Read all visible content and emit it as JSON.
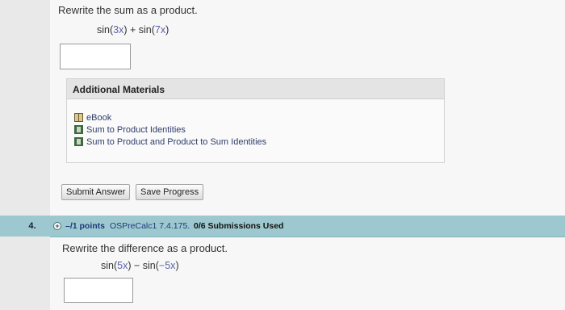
{
  "q3": {
    "prompt": "Rewrite the sum as a product.",
    "expr": {
      "p1": "sin(",
      "a1": "3x",
      "p2": ") + sin(",
      "a2": "7x",
      "p3": ")"
    }
  },
  "additional_materials": {
    "title": "Additional Materials",
    "items": [
      {
        "label": "eBook",
        "icon": "book-icon"
      },
      {
        "label": "Sum to Product Identities",
        "icon": "document-icon"
      },
      {
        "label": "Sum to Product and Product to Sum Identities",
        "icon": "document-icon"
      }
    ]
  },
  "buttons": {
    "submit": "Submit Answer",
    "save": "Save Progress"
  },
  "q4": {
    "number": "4.",
    "points": "–/1 points",
    "source": "OSPreCalc1 7.4.175.",
    "submissions": "0/6 Submissions Used",
    "prompt": "Rewrite the difference as a product.",
    "expr": {
      "p1": "sin(",
      "a1": "5x",
      "p2": ") − sin(",
      "a2": "−5x",
      "p3": ")"
    }
  },
  "colors": {
    "q_header": "#9ec8cf",
    "link": "#2f3d6a",
    "accent_var": "#5b62a8"
  }
}
